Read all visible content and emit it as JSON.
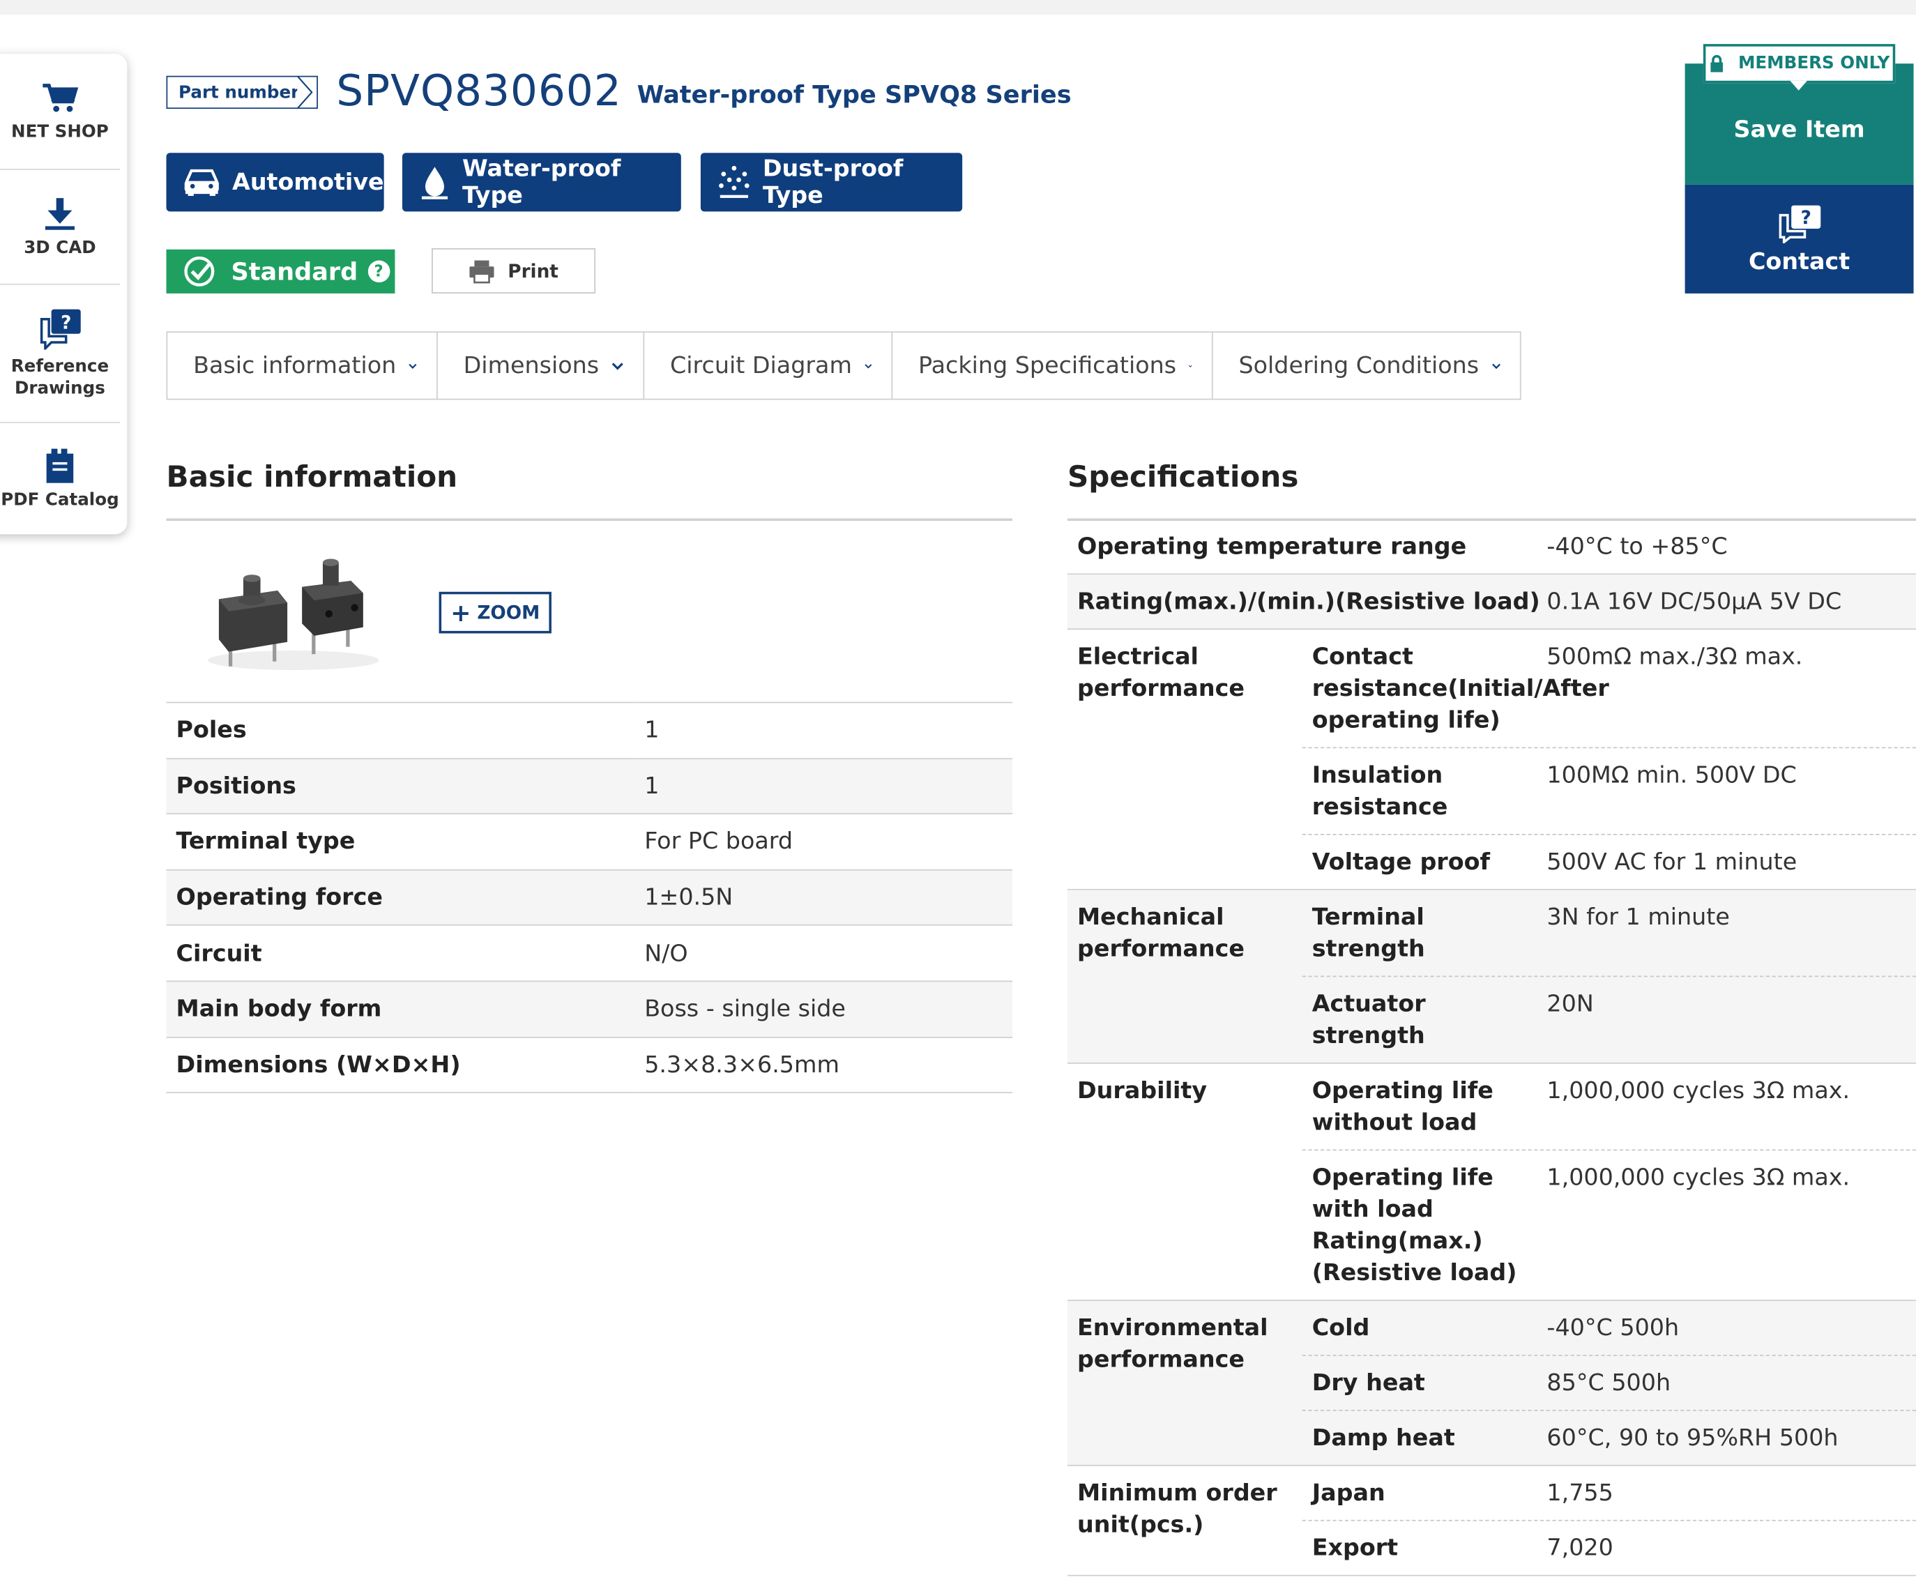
{
  "sidebar": {
    "items": [
      {
        "label": "NET SHOP",
        "icon": "cart-icon"
      },
      {
        "label": "3D CAD",
        "icon": "download-icon"
      },
      {
        "label": "Reference\nDrawings",
        "icon": "question-chat-icon"
      },
      {
        "label": "PDF Catalog",
        "icon": "catalog-icon"
      }
    ]
  },
  "header": {
    "part_number_label": "Part number",
    "part_number": "SPVQ830602",
    "series": "Water-proof Type SPVQ8 Series",
    "tags": [
      "Automotive",
      "Water-proof Type",
      "Dust-proof Type"
    ],
    "standard_label": "Standard",
    "standard_help": "?",
    "print_label": "Print"
  },
  "actions": {
    "members_only": "MEMBERS ONLY",
    "save_item": "Save Item",
    "contact": "Contact"
  },
  "tabs": [
    "Basic information",
    "Dimensions",
    "Circuit Diagram",
    "Packing Specifications",
    "Soldering Conditions"
  ],
  "basic_info": {
    "title": "Basic information",
    "zoom_label": "ZOOM",
    "rows": [
      {
        "key": "Poles",
        "value": "1"
      },
      {
        "key": "Positions",
        "value": "1"
      },
      {
        "key": "Terminal type",
        "value": "For PC board"
      },
      {
        "key": "Operating force",
        "value": "1±0.5N"
      },
      {
        "key": "Circuit",
        "value": "N/O"
      },
      {
        "key": "Main body form",
        "value": "Boss - single side"
      },
      {
        "key": "Dimensions (W×D×H)",
        "value": "5.3×8.3×6.5mm"
      }
    ]
  },
  "specifications": {
    "title": "Specifications",
    "operating_temperature": {
      "key": "Operating temperature range",
      "value": "-40°C to +85°C"
    },
    "rating": {
      "key": "Rating(max.)/(min.)(Resistive load)",
      "value": "0.1A 16V DC/50μA 5V DC"
    },
    "electrical": {
      "group": "Electrical performance",
      "items": [
        {
          "key": "Contact resistance(Initial/After operating life)",
          "value": "500mΩ max./3Ω max."
        },
        {
          "key": "Insulation resistance",
          "value": "100MΩ min. 500V DC"
        },
        {
          "key": "Voltage proof",
          "value": "500V AC for 1 minute"
        }
      ]
    },
    "mechanical": {
      "group": "Mechanical performance",
      "items": [
        {
          "key": "Terminal strength",
          "value": "3N for 1 minute"
        },
        {
          "key": "Actuator strength",
          "value": "20N"
        }
      ]
    },
    "durability": {
      "group": "Durability",
      "items": [
        {
          "key": "Operating life without load",
          "value": "1,000,000 cycles 3Ω max."
        },
        {
          "key": "Operating life with load Rating(max.)(Resistive load)",
          "value": "1,000,000 cycles 3Ω max."
        }
      ]
    },
    "environmental": {
      "group": "Environmental performance",
      "items": [
        {
          "key": "Cold",
          "value": "-40°C 500h"
        },
        {
          "key": "Dry heat",
          "value": "85°C 500h"
        },
        {
          "key": "Damp heat",
          "value": "60°C, 90 to 95%RH 500h"
        }
      ]
    },
    "min_order": {
      "group": "Minimum order unit(pcs.)",
      "items": [
        {
          "key": "Japan",
          "value": "1,755"
        },
        {
          "key": "Export",
          "value": "7,020"
        }
      ]
    }
  },
  "colors": {
    "navy": "#0f3e7e",
    "teal": "#15807a",
    "green": "#20a060"
  }
}
